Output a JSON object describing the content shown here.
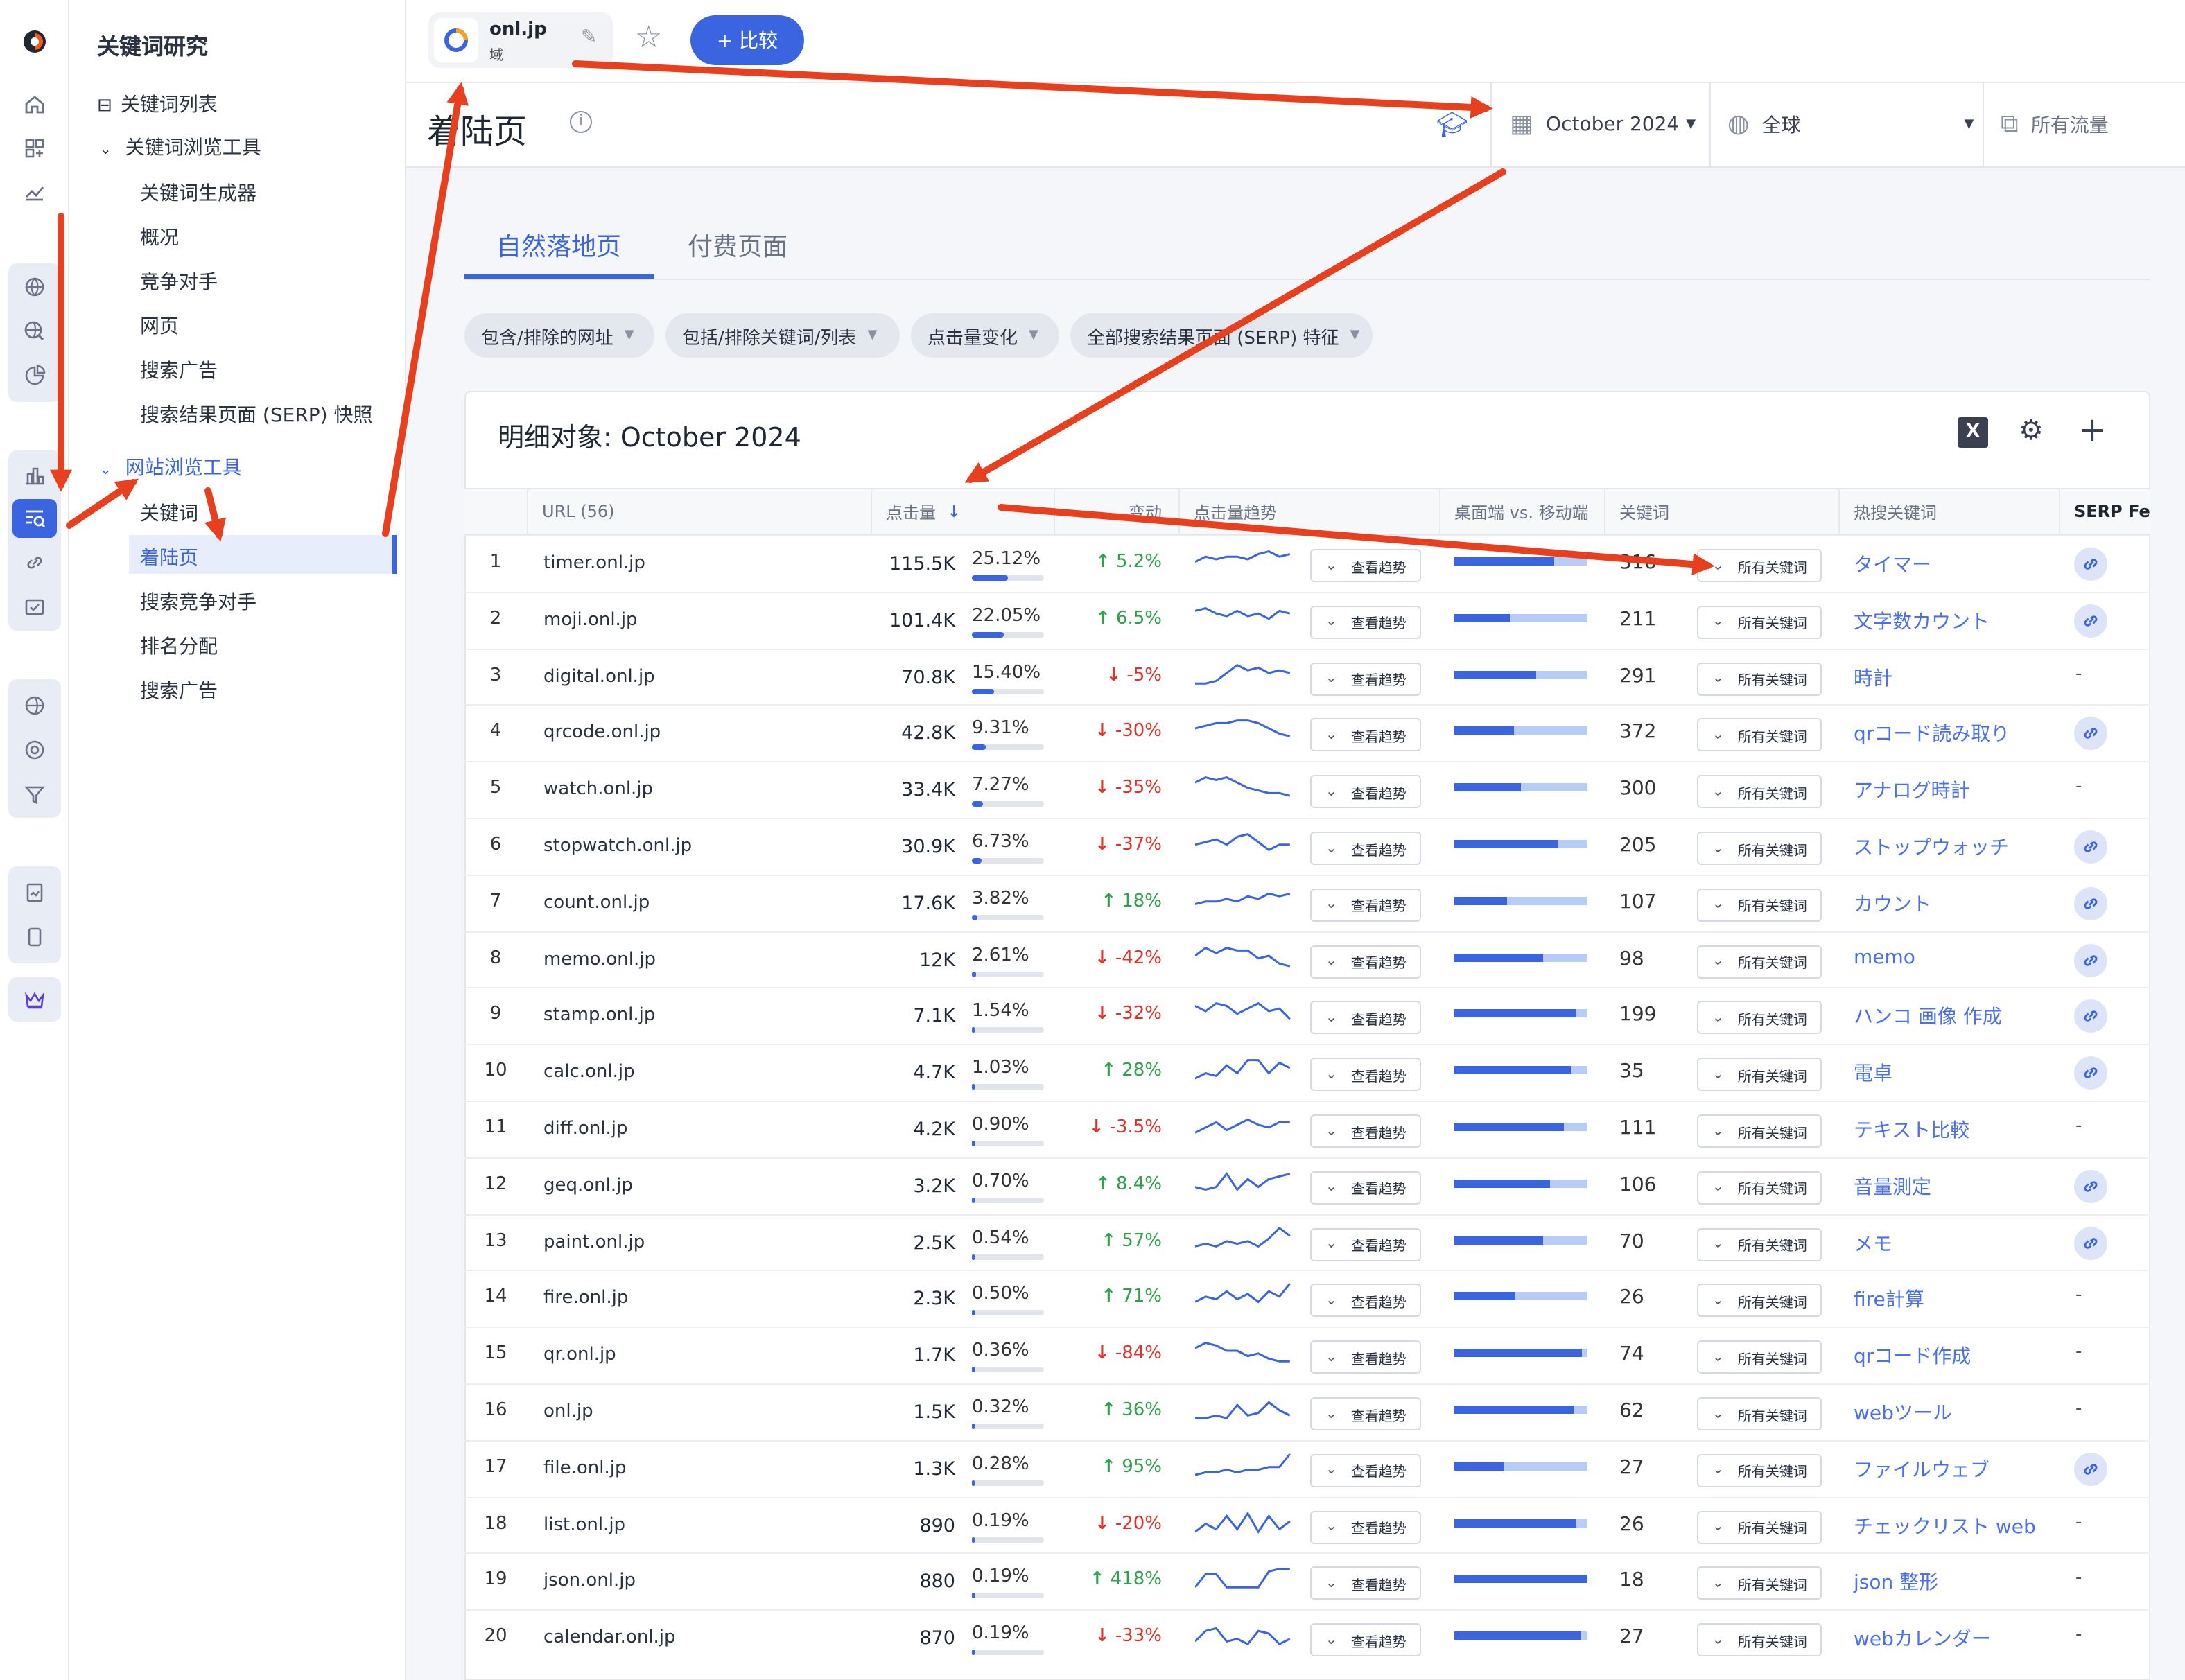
{
  "nav": {
    "title": "关键词研究",
    "keyword_list": "关键词列表",
    "keyword_explorer": "关键词浏览工具",
    "kw_items": [
      "关键词生成器",
      "概况",
      "竞争对手",
      "网页",
      "搜索广告",
      "搜索结果页面 (SERP) 快照"
    ],
    "site_explorer": "网站浏览工具",
    "site_items": [
      "关键词",
      "着陆页",
      "搜索竞争对手",
      "排名分配",
      "搜索广告"
    ]
  },
  "topbar": {
    "domain": "onl.jp",
    "domain_sub": "域",
    "compare": "+ 比较"
  },
  "header": {
    "title": "着陆页",
    "date": "October 2024",
    "region": "全球",
    "traffic": "所有流量"
  },
  "tabs": [
    "自然落地页",
    "付费页面"
  ],
  "filters": [
    "包含/排除的网址",
    "包括/排除关键词/列表",
    "点击量变化",
    "全部搜索结果页面 (SERP) 特征"
  ],
  "card": {
    "title": "明细对象:  October 2024"
  },
  "columns": [
    "URL (56)",
    "点击量",
    "变动",
    "点击量趋势",
    "桌面端 vs. 移动端",
    "关键词",
    "热搜关键词",
    "SERP Feat"
  ],
  "trend_btn": "查看趋势",
  "kw_btn": "所有关键词",
  "colors": {
    "accent": "#3a64e0",
    "up": "#2fa14a",
    "down": "#e0332b",
    "annotation": "#e8401f"
  },
  "rows": [
    {
      "n": "1",
      "url": "timer.onl.jp",
      "clicks": "115.5K",
      "share": "25.12%",
      "share_v": 25.12,
      "chg": "5.2%",
      "up": true,
      "desk": 0.75,
      "kw": "316",
      "top": "タイマー",
      "serp": true,
      "spark": [
        6,
        4,
        5,
        4,
        4,
        5,
        3,
        2,
        4,
        3
      ]
    },
    {
      "n": "2",
      "url": "moji.onl.jp",
      "clicks": "101.4K",
      "share": "22.05%",
      "share_v": 22.05,
      "chg": "6.5%",
      "up": true,
      "desk": 0.42,
      "kw": "211",
      "top": "文字数カウント",
      "serp": true,
      "spark": [
        3,
        2,
        4,
        5,
        3,
        5,
        4,
        6,
        3,
        4
      ]
    },
    {
      "n": "3",
      "url": "digital.onl.jp",
      "clicks": "70.8K",
      "share": "15.40%",
      "share_v": 15.4,
      "chg": "-5%",
      "up": false,
      "desk": 0.61,
      "kw": "291",
      "top": "時計",
      "serp": false,
      "spark": [
        9,
        9,
        8,
        5,
        2,
        4,
        3,
        5,
        4,
        5
      ]
    },
    {
      "n": "4",
      "url": "qrcode.onl.jp",
      "clicks": "42.8K",
      "share": "9.31%",
      "share_v": 9.31,
      "chg": "-30%",
      "up": false,
      "desk": 0.45,
      "kw": "372",
      "top": "qrコード読み取り",
      "serp": true,
      "spark": [
        5,
        4,
        3,
        3,
        2,
        2,
        3,
        5,
        7,
        8
      ]
    },
    {
      "n": "5",
      "url": "watch.onl.jp",
      "clicks": "33.4K",
      "share": "7.27%",
      "share_v": 7.27,
      "chg": "-35%",
      "up": false,
      "desk": 0.5,
      "kw": "300",
      "top": "アナログ時計",
      "serp": false,
      "spark": [
        4,
        2,
        3,
        2,
        4,
        6,
        7,
        8,
        8,
        9
      ]
    },
    {
      "n": "6",
      "url": "stopwatch.onl.jp",
      "clicks": "30.9K",
      "share": "6.73%",
      "share_v": 6.73,
      "chg": "-37%",
      "up": false,
      "desk": 0.78,
      "kw": "205",
      "top": "ストップウォッチ",
      "serp": true,
      "spark": [
        6,
        5,
        4,
        6,
        3,
        2,
        5,
        8,
        6,
        6
      ]
    },
    {
      "n": "7",
      "url": "count.onl.jp",
      "clicks": "17.6K",
      "share": "3.82%",
      "share_v": 3.82,
      "chg": "18%",
      "up": true,
      "desk": 0.4,
      "kw": "107",
      "top": "カウント",
      "serp": true,
      "spark": [
        7,
        6,
        6,
        5,
        6,
        4,
        5,
        3,
        4,
        3
      ]
    },
    {
      "n": "8",
      "url": "memo.onl.jp",
      "clicks": "12K",
      "share": "2.61%",
      "share_v": 2.61,
      "chg": "-42%",
      "up": false,
      "desk": 0.67,
      "kw": "98",
      "top": "memo",
      "serp": true,
      "spark": [
        5,
        2,
        4,
        2,
        3,
        3,
        6,
        5,
        8,
        9
      ]
    },
    {
      "n": "9",
      "url": "stamp.onl.jp",
      "clicks": "7.1K",
      "share": "1.54%",
      "share_v": 1.54,
      "chg": "-32%",
      "up": false,
      "desk": 0.92,
      "kw": "199",
      "top": "ハンコ 画像 作成",
      "serp": true,
      "spark": [
        3,
        5,
        2,
        3,
        6,
        4,
        2,
        5,
        4,
        8
      ]
    },
    {
      "n": "10",
      "url": "calc.onl.jp",
      "clicks": "4.7K",
      "share": "1.03%",
      "share_v": 1.03,
      "chg": "28%",
      "up": true,
      "desk": 0.87,
      "kw": "35",
      "top": "電卓",
      "serp": true,
      "spark": [
        9,
        7,
        8,
        4,
        7,
        2,
        2,
        7,
        3,
        5
      ]
    },
    {
      "n": "11",
      "url": "diff.onl.jp",
      "clicks": "4.2K",
      "share": "0.90%",
      "share_v": 0.9,
      "chg": "-3.5%",
      "up": false,
      "desk": 0.82,
      "kw": "111",
      "top": "テキスト比較",
      "serp": false,
      "spark": [
        8,
        6,
        4,
        7,
        5,
        3,
        5,
        6,
        4,
        4
      ]
    },
    {
      "n": "12",
      "url": "geq.onl.jp",
      "clicks": "3.2K",
      "share": "0.70%",
      "share_v": 0.7,
      "chg": "8.4%",
      "up": true,
      "desk": 0.72,
      "kw": "106",
      "top": "音量測定",
      "serp": true,
      "spark": [
        7,
        8,
        7,
        2,
        8,
        4,
        7,
        4,
        3,
        2
      ]
    },
    {
      "n": "13",
      "url": "paint.onl.jp",
      "clicks": "2.5K",
      "share": "0.54%",
      "share_v": 0.54,
      "chg": "57%",
      "up": true,
      "desk": 0.67,
      "kw": "70",
      "top": "メモ",
      "serp": true,
      "spark": [
        8,
        7,
        8,
        6,
        7,
        6,
        8,
        5,
        1,
        4
      ]
    },
    {
      "n": "14",
      "url": "fire.onl.jp",
      "clicks": "2.3K",
      "share": "0.50%",
      "share_v": 0.5,
      "chg": "71%",
      "up": true,
      "desk": 0.46,
      "kw": "26",
      "top": "fire計算",
      "serp": false,
      "spark": [
        8,
        6,
        7,
        4,
        7,
        5,
        8,
        4,
        6,
        1
      ]
    },
    {
      "n": "15",
      "url": "qr.onl.jp",
      "clicks": "1.7K",
      "share": "0.36%",
      "share_v": 0.36,
      "chg": "-84%",
      "up": false,
      "desk": 0.96,
      "kw": "74",
      "top": "qrコード作成",
      "serp": false,
      "spark": [
        4,
        2,
        3,
        5,
        5,
        7,
        6,
        8,
        9,
        9
      ]
    },
    {
      "n": "16",
      "url": "onl.jp",
      "clicks": "1.5K",
      "share": "0.32%",
      "share_v": 0.32,
      "chg": "36%",
      "up": true,
      "desk": 0.9,
      "kw": "62",
      "top": "webツール",
      "serp": false,
      "spark": [
        9,
        9,
        8,
        9,
        4,
        8,
        7,
        3,
        6,
        8
      ]
    },
    {
      "n": "17",
      "url": "file.onl.jp",
      "clicks": "1.3K",
      "share": "0.28%",
      "share_v": 0.28,
      "chg": "95%",
      "up": true,
      "desk": 0.38,
      "kw": "27",
      "top": "ファイルウェブ",
      "serp": true,
      "spark": [
        9,
        8,
        8,
        7,
        8,
        7,
        7,
        6,
        6,
        1
      ]
    },
    {
      "n": "18",
      "url": "list.onl.jp",
      "clicks": "890",
      "share": "0.19%",
      "share_v": 0.19,
      "chg": "-20%",
      "up": false,
      "desk": 0.92,
      "kw": "26",
      "top": "チェックリスト web",
      "serp": false,
      "spark": [
        9,
        6,
        8,
        3,
        8,
        2,
        9,
        3,
        8,
        5
      ]
    },
    {
      "n": "19",
      "url": "json.onl.jp",
      "clicks": "880",
      "share": "0.19%",
      "share_v": 0.19,
      "chg": "418%",
      "up": true,
      "desk": 1.0,
      "kw": "18",
      "top": "json 整形",
      "serp": false,
      "spark": [
        9,
        4,
        4,
        9,
        9,
        9,
        9,
        3,
        2,
        2
      ]
    },
    {
      "n": "20",
      "url": "calendar.onl.jp",
      "clicks": "870",
      "share": "0.19%",
      "share_v": 0.19,
      "chg": "-33%",
      "up": false,
      "desk": 0.95,
      "kw": "27",
      "top": "webカレンダー",
      "serp": false,
      "spark": [
        8,
        4,
        3,
        8,
        7,
        9,
        4,
        5,
        9,
        7
      ]
    }
  ]
}
